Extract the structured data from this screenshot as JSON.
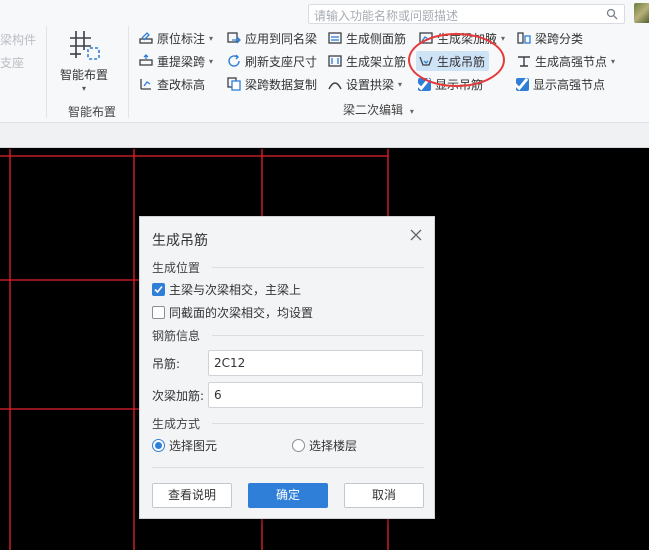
{
  "search": {
    "placeholder": "请输入功能名称或问题描述"
  },
  "left_cut": {
    "line1": "梁构件",
    "line2": "支座"
  },
  "smart": {
    "label": "智能布置",
    "group_title": "智能布置"
  },
  "ribbon": {
    "group_title": "梁二次编辑",
    "col1": [
      "原位标注",
      "重提梁跨",
      "查改标高"
    ],
    "col2": [
      "应用到同名梁",
      "刷新支座尺寸",
      "梁跨数据复制"
    ],
    "col3": [
      "生成侧面筋",
      "生成架立筋",
      "设置拱梁"
    ],
    "col4": [
      "生成梁加腋",
      "生成吊筋",
      "显示吊筋"
    ],
    "col5": [
      "梁跨分类",
      "生成高强节点",
      "显示高强节点"
    ]
  },
  "dialog": {
    "title": "生成吊筋",
    "section_position": "生成位置",
    "opt_main_secondary": "主梁与次梁相交，主梁上",
    "opt_same_section": "同截面的次梁相交，均设置",
    "section_rebar": "钢筋信息",
    "hanger_label": "吊筋:",
    "hanger_value": "2C12",
    "secondary_label": "次梁加筋:",
    "secondary_value": "6",
    "section_method": "生成方式",
    "radio_select_element": "选择图元",
    "radio_select_floor": "选择楼层",
    "btn_help": "查看说明",
    "btn_ok": "确定",
    "btn_cancel": "取消"
  },
  "colors": {
    "accent": "#2f7ed8",
    "highlight_ring": "#e5393a",
    "grid_line": "#e8222d",
    "canvas_bg": "#000000"
  }
}
